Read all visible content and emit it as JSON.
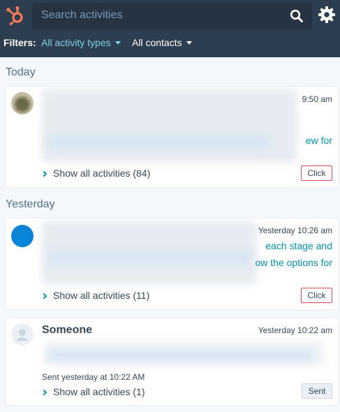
{
  "search": {
    "placeholder": "Search activities"
  },
  "filters": {
    "label": "Filters:",
    "activity_types": "All activity types",
    "contacts": "All contacts"
  },
  "sections": {
    "today": "Today",
    "yesterday": "Yesterday"
  },
  "cards": [
    {
      "time": "9:50 am",
      "link_fragment": "ew for",
      "show_all": "Show all activities (84)",
      "tag": "Click"
    },
    {
      "time": "Yesterday 10:26 am",
      "link_line1": "each stage and",
      "link_line2": "ow the options for",
      "show_all": "Show all activities (11)",
      "tag": "Click"
    },
    {
      "time": "Yesterday 10:22 am",
      "name": "Someone",
      "sent_note": "Sent yesterday at 10:22 AM",
      "show_all": "Show all activities (1)",
      "tag": "Sent"
    }
  ],
  "colors": {
    "topbar": "#2d3e50",
    "accent": "#0091ae",
    "filter_accent": "#7fd1de",
    "logo": "#ff7a59",
    "click_border": "#d94c53"
  },
  "icons": {
    "logo": "hubspot-logo-icon",
    "search": "search-icon",
    "settings": "gear-icon",
    "chevron": "chevron-right-icon"
  }
}
